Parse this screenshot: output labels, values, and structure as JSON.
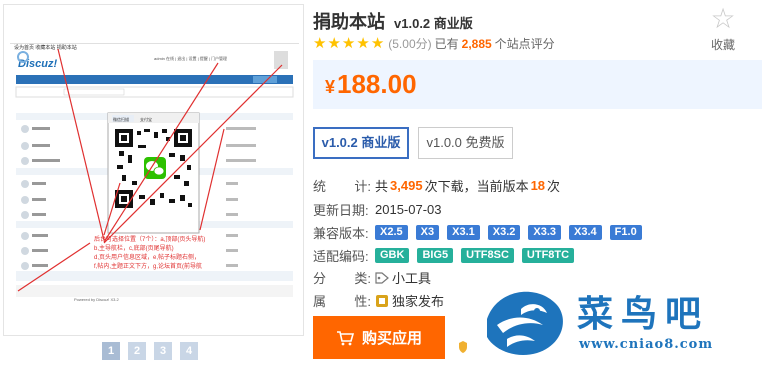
{
  "preview": {
    "browser_tabs": "设为首页 收藏本站 捐助本站",
    "forum_logo": "Discuz!",
    "user_bar": "admin 在线 | 退出 | 设置 | 提醒 | 门户管理",
    "popup_tab_a": "微信扫描",
    "popup_tab_b": "支付宝",
    "annotation_line1": "后台可选择位置（7个）：a,顶部(页头导航)",
    "annotation_line2": "b,主导航栏，c,底部(页尾导航)",
    "annotation_line3": "d,页头用户信息区域，e,帖子标题右侧，",
    "annotation_line4": "f,帖内,主题正文下方，g,论坛首页(前导航",
    "footer": "Powered by Discuz! X3.2",
    "thumbs": [
      "1",
      "2",
      "3",
      "4"
    ]
  },
  "product": {
    "title": "捐助本站",
    "version_text": "v1.0.2 商业版",
    "rating_score": "(5.00分)",
    "rating_prefix": "已有",
    "rating_count": "2,885",
    "rating_suffix": "个站点评分",
    "stars": 5,
    "favorite_label": "收藏"
  },
  "price": {
    "currency": "¥",
    "amount": "188.00"
  },
  "versions": [
    {
      "label": "v1.0.2 商业版",
      "selected": true
    },
    {
      "label": "v1.0.0 免费版",
      "selected": false
    }
  ],
  "stats": {
    "label_a": "统",
    "label_b": "计:",
    "prefix": "共",
    "downloads": "3,495",
    "mid": "次下载，当前版本",
    "version_downloads": "18",
    "suffix": "次"
  },
  "updated": {
    "label": "更新日期:",
    "value": "2015-07-03"
  },
  "compat": {
    "label": "兼容版本:",
    "tags": [
      "X2.5",
      "X3",
      "X3.1",
      "X3.2",
      "X3.3",
      "X3.4",
      "F1.0"
    ]
  },
  "encoding": {
    "label": "适配编码:",
    "tags": [
      "GBK",
      "BIG5",
      "UTF8SC",
      "UTF8TC"
    ]
  },
  "category": {
    "label_a": "分",
    "label_b": "类:",
    "value": "小工具",
    "icon": "tag-icon"
  },
  "attribute": {
    "label_a": "属",
    "label_b": "性:",
    "value": "独家发布",
    "icon": "exclusive-icon"
  },
  "buy_button": "购买应用",
  "watermark": {
    "text": "菜鸟吧",
    "url": "www.cniao8.com"
  },
  "colors": {
    "accent": "#ff6600",
    "blue": "#3a7bd5",
    "green": "#26b09b",
    "star": "#ffc200"
  }
}
